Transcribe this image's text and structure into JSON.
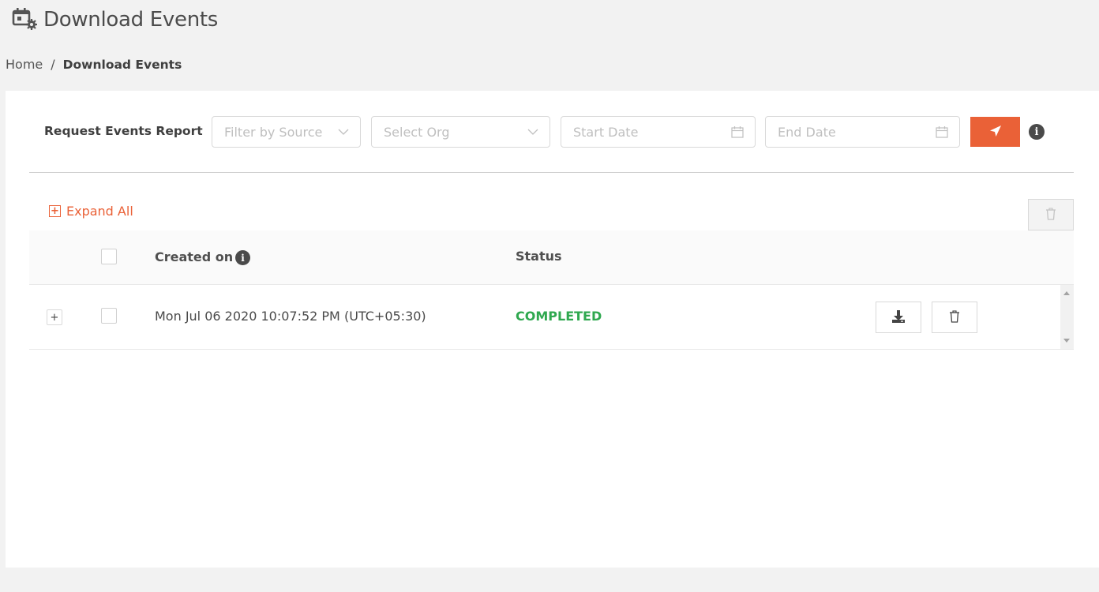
{
  "header": {
    "title": "Download Events",
    "icon": "calendar-gear-icon"
  },
  "breadcrumb": {
    "home": "Home",
    "separator": "/",
    "current": "Download Events"
  },
  "filters": {
    "label": "Request Events Report",
    "source": {
      "placeholder": "Filter by Source",
      "value": ""
    },
    "org": {
      "placeholder": "Select Org",
      "value": ""
    },
    "start_date": {
      "placeholder": "Start Date",
      "value": ""
    },
    "end_date": {
      "placeholder": "End Date",
      "value": ""
    },
    "submit_icon": "paper-plane-icon",
    "info_icon": "info-icon"
  },
  "toolbar": {
    "expand_all_label": "Expand All",
    "expand_all_symbol": "+"
  },
  "table": {
    "columns": [
      {
        "label": "Created on",
        "has_info": true
      },
      {
        "label": "Status"
      }
    ],
    "rows": [
      {
        "expand_symbol": "+",
        "created_on": "Mon Jul 06 2020 10:07:52 PM (UTC+05:30)",
        "status": "COMPLETED",
        "checked": false
      }
    ]
  },
  "colors": {
    "accent": "#ea6137",
    "status_completed": "#2fa84f",
    "background": "#f2f2f2"
  }
}
